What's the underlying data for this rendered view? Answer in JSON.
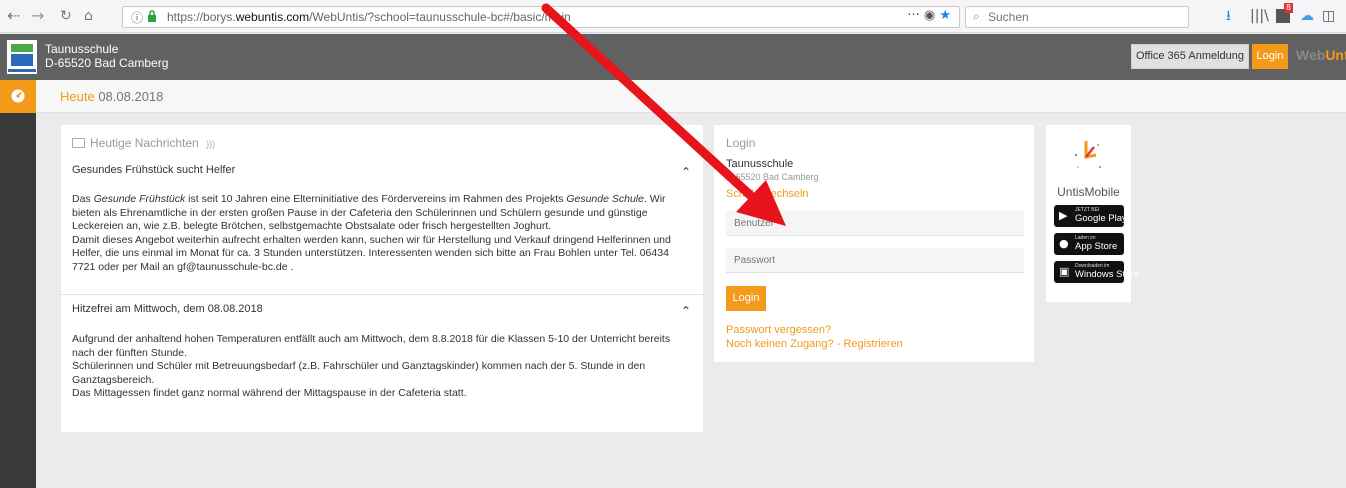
{
  "browser": {
    "url_prefix": "https://borys.",
    "url_domain": "webuntis.com",
    "url_rest": "/WebUntis/?school=taunusschule-bc#/basic/main",
    "url_actions": "···",
    "search_placeholder": "Suchen",
    "icon_badge": "8"
  },
  "header": {
    "school_name": "Taunusschule",
    "school_address": "D-65520 Bad Camberg",
    "office_button": "Office 365 Anmeldung",
    "login_button": "Login",
    "brand_prefix": "Web",
    "brand_suffix": "Unt"
  },
  "date_bar": {
    "today_label": "Heute",
    "date": "08.08.2018"
  },
  "news": {
    "title": "Heutige Nachrichten",
    "items": [
      {
        "title": "Gesundes Frühstück sucht Helfer",
        "body_1": "Das ",
        "body_em1": "Gesunde Frühstück",
        "body_2": " ist seit 10 Jahren eine Elterninitiative des Fördervereins im Rahmen des Projekts ",
        "body_em2": "Gesunde Schule",
        "body_3": ". Wir bieten als Ehrenamtliche in der ersten großen Pause in der Cafeteria den Schülerinnen und Schülern gesunde und günstige Leckereien an, wie z.B. belegte Brötchen, selbstgemachte Obstsalate oder frisch hergestellten Joghurt.",
        "body_4": "Damit dieses Angebot weiterhin aufrecht erhalten werden kann, suchen wir für Herstellung und Verkauf dringend Helferinnen und Helfer, die uns einmal im Monat für ca. 3 Stunden unterstützen. Interessenten wenden sich bitte an Frau Bohlen unter Tel. 06434 7721 oder per Mail an gf@taunusschule-bc.de ."
      },
      {
        "title": "Hitzefrei am Mittwoch, dem 08.08.2018",
        "body_1": "Aufgrund der anhaltend hohen Temperaturen entfällt auch am Mittwoch, dem 8.8.2018 für die Klassen 5-10 der Unterricht bereits nach der fünften Stunde.",
        "body_2": "Schülerinnen und Schüler mit Betreuungsbedarf (z.B. Fahrschüler und Ganztagskinder) kommen nach der 5. Stunde in den Ganztagsbereich.",
        "body_3": "Das Mittagessen findet ganz normal während der Mittagspause in der Cafeteria statt."
      }
    ]
  },
  "login": {
    "title": "Login",
    "school": "Taunusschule",
    "address": "D-65520 Bad Camberg",
    "switch_school": "Schule wechseln",
    "user_placeholder": "Benutzer",
    "password_placeholder": "Passwort",
    "submit": "Login",
    "forgot": "Passwort vergessen?",
    "register": "Noch keinen Zugang? - Registrieren"
  },
  "mobile": {
    "name_prefix": "Untis",
    "name_suffix": "Mobile",
    "google_small": "JETZT BEI",
    "google_big": "Google Play",
    "apple_small": "Laden im",
    "apple_big": "App Store",
    "windows_small": "Downloaden im",
    "windows_big": "Windows Store"
  },
  "colors": {
    "accent": "#f49a1a",
    "header_bg": "#616161",
    "sidebar_bg": "#3a3a3a",
    "annotation": "#e8141b"
  }
}
